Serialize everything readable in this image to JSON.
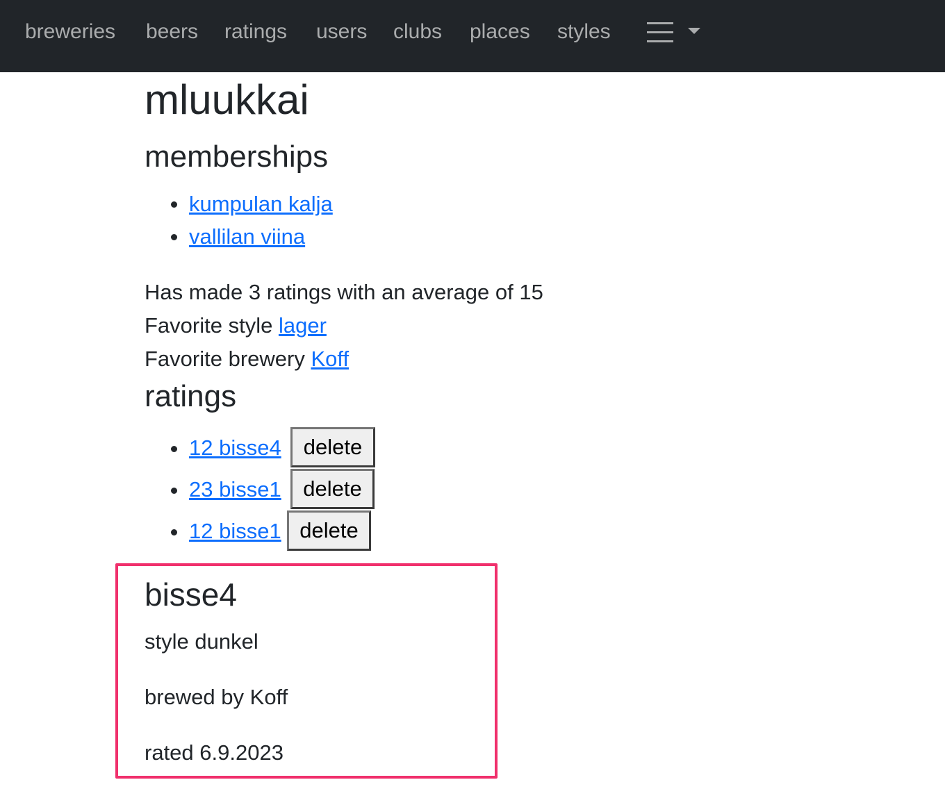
{
  "nav": {
    "links": [
      "breweries",
      "beers",
      "ratings",
      "users",
      "clubs",
      "places",
      "styles"
    ],
    "menu_icon": "hamburger-icon",
    "dropdown_icon": "caret-down-icon"
  },
  "user": {
    "name": "mluukkai"
  },
  "memberships": {
    "heading": "memberships",
    "items": [
      "kumpulan kalja",
      "vallilan viina"
    ]
  },
  "stats": {
    "summary": "Has made 3 ratings with an average of 15",
    "favorite_style_label": "Favorite style",
    "favorite_style": "lager",
    "favorite_brewery_label": "Favorite brewery",
    "favorite_brewery": "Koff"
  },
  "ratings": {
    "heading": "ratings",
    "delete_label": "delete",
    "items": [
      "12 bisse4",
      "23 bisse1",
      "12 bisse1"
    ]
  },
  "beer_detail": {
    "name": "bisse4",
    "style": "style dunkel",
    "brewed_by": "brewed by Koff",
    "rated": "rated 6.9.2023"
  },
  "colors": {
    "navbar_bg": "#212529",
    "link": "#0d6efd",
    "highlight": "#f0306c"
  }
}
